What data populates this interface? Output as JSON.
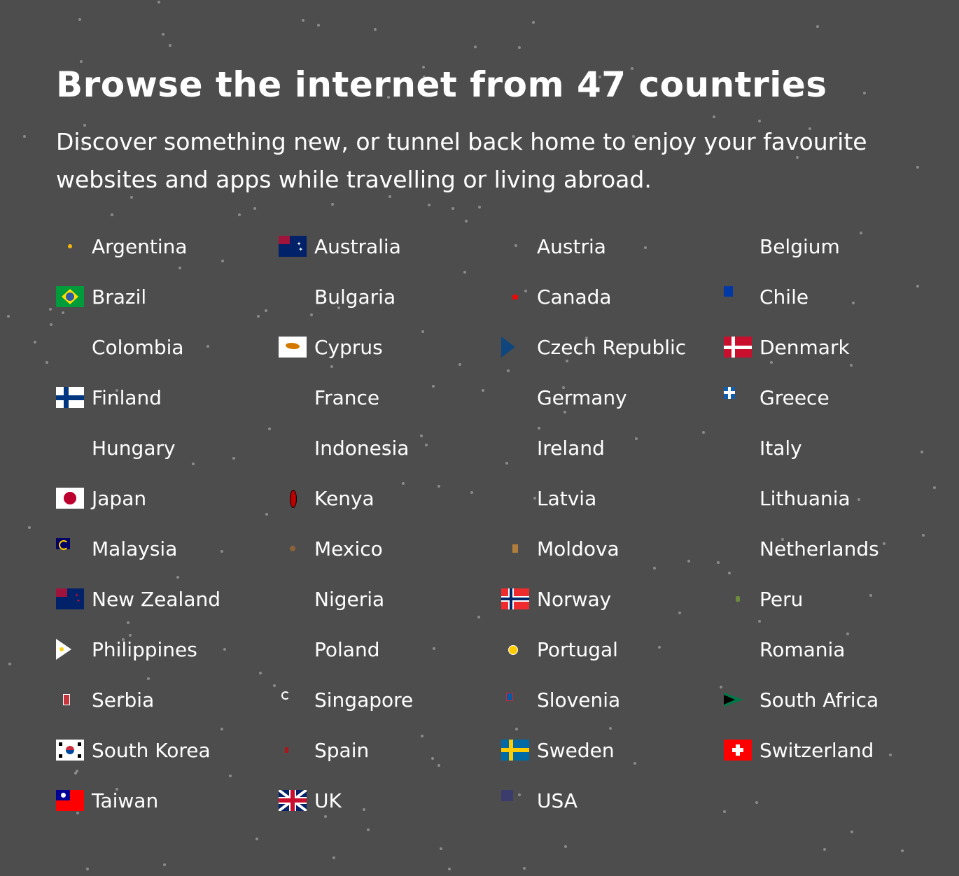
{
  "title": "Browse the internet from 47 countries",
  "subtitle": "Discover something new, or tunnel back home to enjoy your favourite websites and apps while travelling or living abroad.",
  "countries": [
    {
      "name": "Argentina",
      "flag": "argentina-flag"
    },
    {
      "name": "Australia",
      "flag": "australia-flag"
    },
    {
      "name": "Austria",
      "flag": "austria-flag"
    },
    {
      "name": "Belgium",
      "flag": "belgium-flag"
    },
    {
      "name": "Brazil",
      "flag": "brazil-flag"
    },
    {
      "name": "Bulgaria",
      "flag": "bulgaria-flag"
    },
    {
      "name": "Canada",
      "flag": "canada-flag"
    },
    {
      "name": "Chile",
      "flag": "chile-flag"
    },
    {
      "name": "Colombia",
      "flag": "colombia-flag"
    },
    {
      "name": "Cyprus",
      "flag": "cyprus-flag"
    },
    {
      "name": "Czech Republic",
      "flag": "czech-republic-flag"
    },
    {
      "name": "Denmark",
      "flag": "denmark-flag"
    },
    {
      "name": "Finland",
      "flag": "finland-flag"
    },
    {
      "name": "France",
      "flag": "france-flag"
    },
    {
      "name": "Germany",
      "flag": "germany-flag"
    },
    {
      "name": "Greece",
      "flag": "greece-flag"
    },
    {
      "name": "Hungary",
      "flag": "hungary-flag"
    },
    {
      "name": "Indonesia",
      "flag": "indonesia-flag"
    },
    {
      "name": "Ireland",
      "flag": "ireland-flag"
    },
    {
      "name": "Italy",
      "flag": "italy-flag"
    },
    {
      "name": "Japan",
      "flag": "japan-flag"
    },
    {
      "name": "Kenya",
      "flag": "kenya-flag"
    },
    {
      "name": "Latvia",
      "flag": "latvia-flag"
    },
    {
      "name": "Lithuania",
      "flag": "lithuania-flag"
    },
    {
      "name": "Malaysia",
      "flag": "malaysia-flag"
    },
    {
      "name": "Mexico",
      "flag": "mexico-flag"
    },
    {
      "name": "Moldova",
      "flag": "moldova-flag"
    },
    {
      "name": "Netherlands",
      "flag": "netherlands-flag"
    },
    {
      "name": "New Zealand",
      "flag": "new-zealand-flag"
    },
    {
      "name": "Nigeria",
      "flag": "nigeria-flag"
    },
    {
      "name": "Norway",
      "flag": "norway-flag"
    },
    {
      "name": "Peru",
      "flag": "peru-flag"
    },
    {
      "name": "Philippines",
      "flag": "philippines-flag"
    },
    {
      "name": "Poland",
      "flag": "poland-flag"
    },
    {
      "name": "Portugal",
      "flag": "portugal-flag"
    },
    {
      "name": "Romania",
      "flag": "romania-flag"
    },
    {
      "name": "Serbia",
      "flag": "serbia-flag"
    },
    {
      "name": "Singapore",
      "flag": "singapore-flag"
    },
    {
      "name": "Slovenia",
      "flag": "slovenia-flag"
    },
    {
      "name": "South Africa",
      "flag": "south-africa-flag"
    },
    {
      "name": "South Korea",
      "flag": "south-korea-flag"
    },
    {
      "name": "Spain",
      "flag": "spain-flag"
    },
    {
      "name": "Sweden",
      "flag": "sweden-flag"
    },
    {
      "name": "Switzerland",
      "flag": "switzerland-flag"
    },
    {
      "name": "Taiwan",
      "flag": "taiwan-flag"
    },
    {
      "name": "UK",
      "flag": "uk-flag"
    },
    {
      "name": "USA",
      "flag": "usa-flag"
    }
  ]
}
